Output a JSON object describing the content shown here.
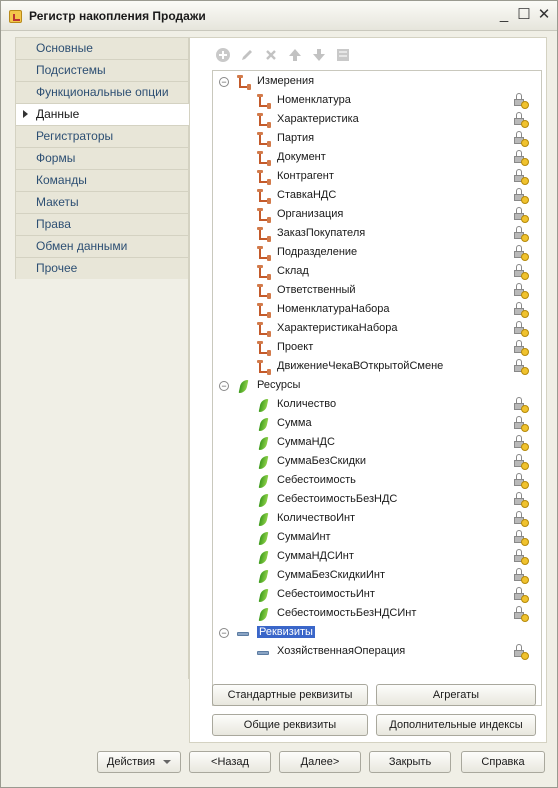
{
  "window": {
    "title": "Регистр накопления Продажи"
  },
  "tabs": [
    {
      "label": "Основные",
      "active": false
    },
    {
      "label": "Подсистемы",
      "active": false
    },
    {
      "label": "Функциональные опции",
      "active": false
    },
    {
      "label": "Данные",
      "active": true
    },
    {
      "label": "Регистраторы",
      "active": false
    },
    {
      "label": "Формы",
      "active": false
    },
    {
      "label": "Команды",
      "active": false
    },
    {
      "label": "Макеты",
      "active": false
    },
    {
      "label": "Права",
      "active": false
    },
    {
      "label": "Обмен данными",
      "active": false
    },
    {
      "label": "Прочее",
      "active": false
    }
  ],
  "toolbar": {
    "icons": [
      "add-icon",
      "edit-icon",
      "delete-icon",
      "move-up-icon",
      "move-down-icon",
      "sort-icon"
    ]
  },
  "tree": {
    "dimensions": {
      "label": "Измерения",
      "items": [
        "Номенклатура",
        "Характеристика",
        "Партия",
        "Документ",
        "Контрагент",
        "СтавкаНДС",
        "Организация",
        "ЗаказПокупателя",
        "Подразделение",
        "Склад",
        "Ответственный",
        "НоменклатураНабора",
        "ХарактеристикаНабора",
        "Проект",
        "ДвижениеЧекаВОткрытойСмене"
      ]
    },
    "resources": {
      "label": "Ресурсы",
      "items": [
        "Количество",
        "Сумма",
        "СуммаНДС",
        "СуммаБезСкидки",
        "Себестоимость",
        "СебестоимостьБезНДС",
        "КоличествоИнт",
        "СуммаИнт",
        "СуммаНДСИнт",
        "СуммаБезСкидкиИнт",
        "СебестоимостьИнт",
        "СебестоимостьБезНДСИнт"
      ]
    },
    "attributes": {
      "label": "Реквизиты",
      "items": [
        "ХозяйственнаяОперация"
      ]
    }
  },
  "panel_buttons": {
    "standard_attrs": "Стандартные реквизиты",
    "aggregates": "Агрегаты",
    "common_attrs": "Общие реквизиты",
    "additional_indexes": "Дополнительные индексы"
  },
  "footer": {
    "actions": "Действия",
    "back": "<Назад",
    "next": "Далее>",
    "close": "Закрыть",
    "help": "Справка"
  },
  "colors": {
    "accent": "#3a66c9",
    "tab_text": "#2d4f73"
  }
}
